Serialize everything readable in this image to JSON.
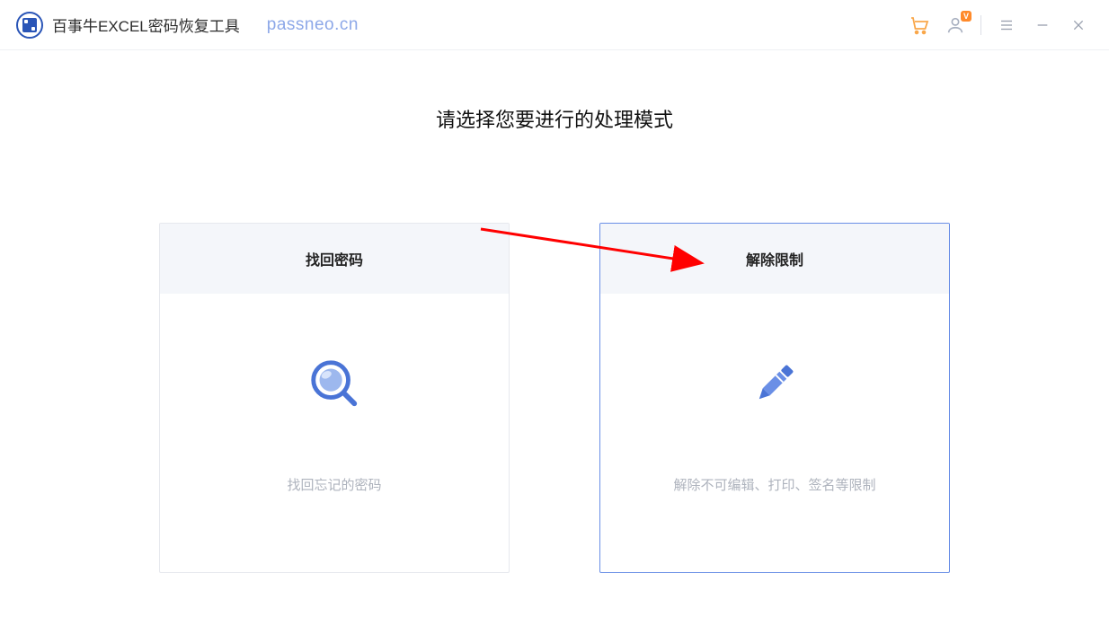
{
  "header": {
    "app_title": "百事牛EXCEL密码恢复工具",
    "site_url": "passneo.cn",
    "icons": {
      "cart": "cart-icon",
      "user": "user-icon",
      "vip_badge": "V",
      "menu": "menu-icon",
      "minimize": "minimize-icon",
      "close": "close-icon"
    }
  },
  "main": {
    "heading": "请选择您要进行的处理模式",
    "cards": [
      {
        "title": "找回密码",
        "desc": "找回忘记的密码",
        "icon": "search-icon",
        "selected": false
      },
      {
        "title": "解除限制",
        "desc": "解除不可编辑、打印、签名等限制",
        "icon": "pencil-icon",
        "selected": true
      }
    ]
  },
  "annotation": {
    "arrow_color": "#ff0000"
  }
}
